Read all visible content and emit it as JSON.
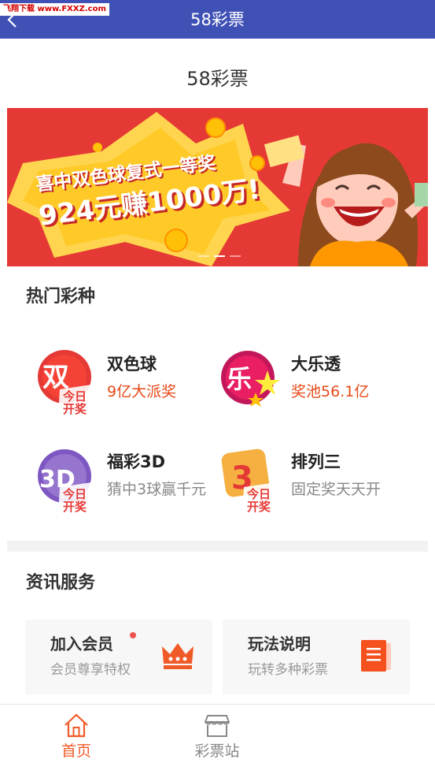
{
  "watermark": "飞翔下载 www.FXXZ.com",
  "titlebar": {
    "title": "58彩票",
    "back_icon": "chevron-left-icon",
    "color": "#3f51b5"
  },
  "page_heading": "58彩票",
  "banner": {
    "line1": "喜中双色球复式一等奖",
    "line2": "924元赚1000万!",
    "bg_color": "#e53935"
  },
  "hot": {
    "title": "热门彩种",
    "games": [
      {
        "name": "双色球",
        "desc": "9亿大派奖",
        "icon_text": "双",
        "badge": "今日开奖"
      },
      {
        "name": "大乐透",
        "desc": "奖池56.1亿",
        "icon_text": "乐"
      },
      {
        "name": "福彩3D",
        "desc": "猜中3球赢千元",
        "icon_text": "3D",
        "badge": "今日开奖"
      },
      {
        "name": "排列三",
        "desc": "固定奖天天开",
        "icon_text": "3",
        "badge": "今日开奖"
      }
    ]
  },
  "services": {
    "title": "资讯服务",
    "cards": [
      {
        "title": "加入会员",
        "subtitle": "会员尊享特权",
        "icon": "crown-icon"
      },
      {
        "title": "玩法说明",
        "subtitle": "玩转多种彩票",
        "icon": "document-icon"
      }
    ]
  },
  "bottom_nav": [
    {
      "label": "首页",
      "icon": "home-icon",
      "active": true
    },
    {
      "label": "彩票站",
      "icon": "store-icon",
      "active": false
    }
  ],
  "colors": {
    "accent": "#f05a28",
    "nav_inactive": "#888888",
    "highlight_text": "#e64a19"
  }
}
